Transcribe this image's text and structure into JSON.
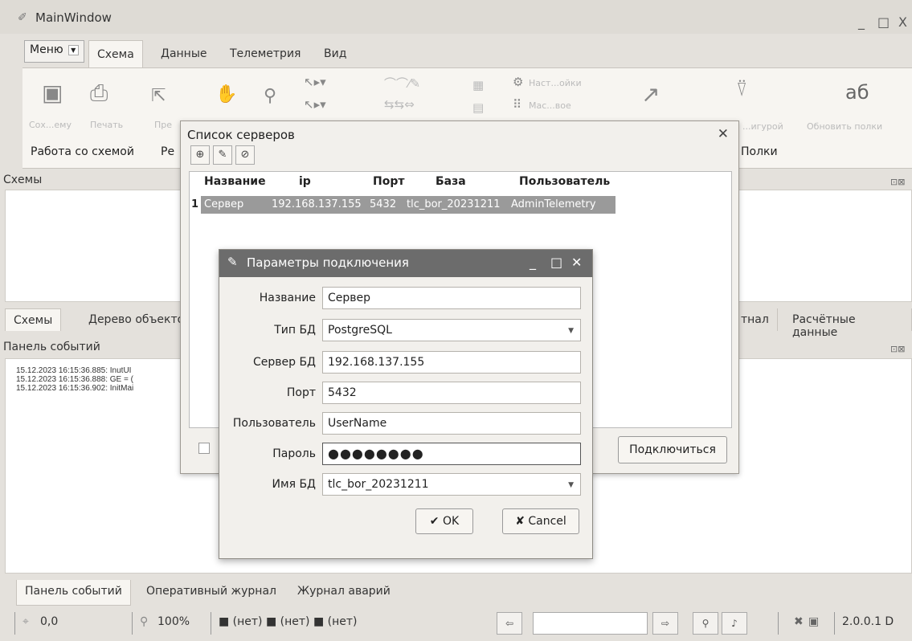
{
  "window": {
    "title": "MainWindow",
    "controls": [
      "_",
      "□",
      "X"
    ]
  },
  "ribbon": {
    "menu_label": "Меню",
    "tabs": [
      "Схема",
      "Данные",
      "Телеметрия",
      "Вид"
    ],
    "active_tab": "Схема",
    "groups": {
      "work": "Работа со схемой",
      "re": "Ре",
      "shelves": "Полки"
    },
    "faded_labels": {
      "save": "Сох...ему",
      "print": "Печать",
      "pr": "Пре",
      "settings": "Наст...ойки",
      "scale": "Мас...вое",
      "figure": "...игурой",
      "update": "Обновить полки"
    }
  },
  "panels": {
    "schemes_title": "Схемы",
    "events_title": "Панель событий",
    "mid_tabs": [
      "Схемы",
      "Дерево объекто"
    ],
    "right_tabs": [
      "тнал",
      "Расчётные данные"
    ]
  },
  "event_log": [
    "15.12.2023 16:15:36.885: InutUI",
    "15.12.2023 16:15:36.888: GE = (",
    "15.12.2023 16:15:36.902: InitMai"
  ],
  "bottom_tabs": [
    "Панель событий",
    "Оперативный журнал",
    "Журнал аварий"
  ],
  "status_bar": {
    "coords": "0,0",
    "zoom": "100%",
    "layers": "■ (нет) ■ (нет) ■ (нет)",
    "version": "2.0.0.1 D"
  },
  "server_dialog": {
    "title": "Список серверов",
    "columns": [
      "Название",
      "ip",
      "Порт",
      "База",
      "Пользователь"
    ],
    "rows": [
      {
        "num": "1",
        "name": "Сервер",
        "ip": "192.168.137.155",
        "port": "5432",
        "db": "tlc_bor_20231211",
        "user": "AdminTelemetry"
      }
    ],
    "connect_label": "Подключиться"
  },
  "connection_dialog": {
    "title": "Параметры подключения",
    "labels": {
      "name": "Название",
      "db_type": "Тип БД",
      "server": "Сервер БД",
      "port": "Порт",
      "user": "Пользователь",
      "password": "Пароль",
      "db_name": "Имя БД"
    },
    "values": {
      "name": "Сервер",
      "db_type": "PostgreSQL",
      "server": "192.168.137.155",
      "port": "5432",
      "user": "UserName",
      "password": "●●●●●●●●",
      "db_name": "tlc_bor_20231211"
    },
    "ok_label": "OK",
    "cancel_label": "Cancel"
  }
}
